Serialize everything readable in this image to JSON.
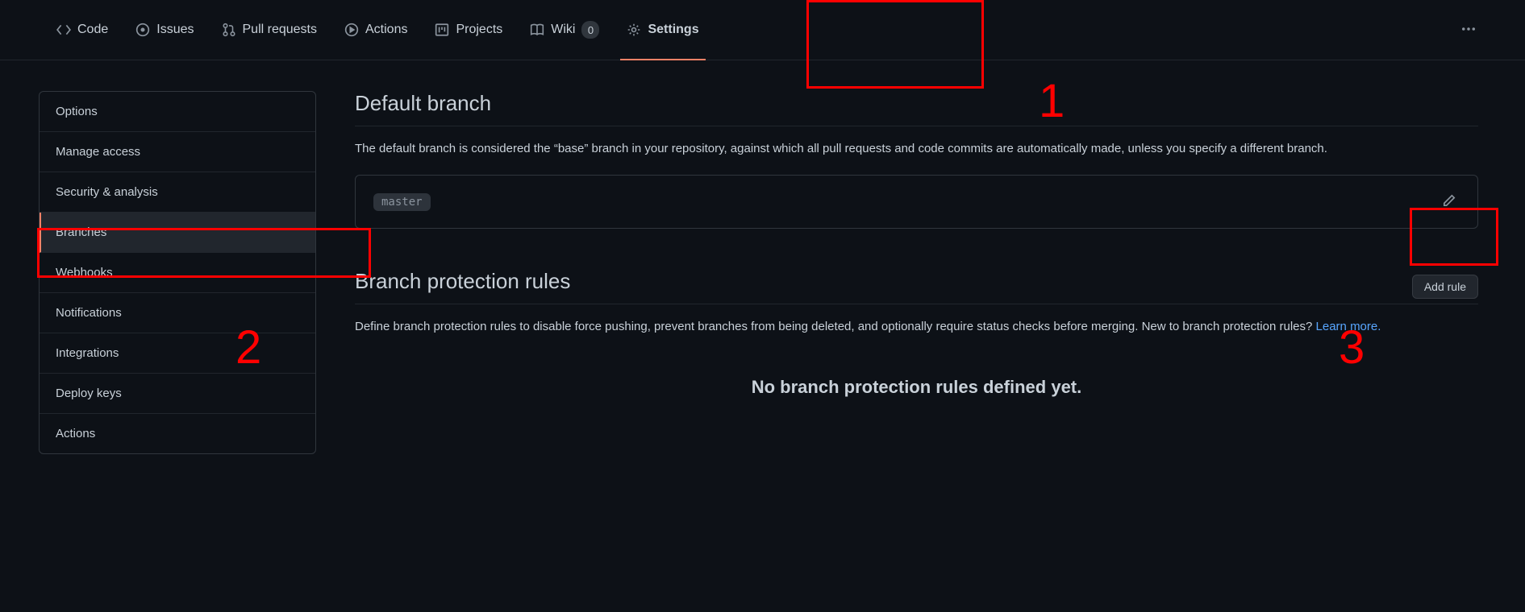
{
  "topnav": {
    "items": [
      {
        "label": "Code",
        "icon": "code"
      },
      {
        "label": "Issues",
        "icon": "issue"
      },
      {
        "label": "Pull requests",
        "icon": "pr"
      },
      {
        "label": "Actions",
        "icon": "play"
      },
      {
        "label": "Projects",
        "icon": "project"
      },
      {
        "label": "Wiki",
        "icon": "book",
        "count": "0"
      },
      {
        "label": "Settings",
        "icon": "gear",
        "selected": true
      }
    ]
  },
  "sidebar": {
    "items": [
      {
        "label": "Options"
      },
      {
        "label": "Manage access"
      },
      {
        "label": "Security & analysis"
      },
      {
        "label": "Branches",
        "active": true
      },
      {
        "label": "Webhooks"
      },
      {
        "label": "Notifications"
      },
      {
        "label": "Integrations"
      },
      {
        "label": "Deploy keys"
      },
      {
        "label": "Actions"
      }
    ]
  },
  "default_branch": {
    "title": "Default branch",
    "desc": "The default branch is considered the “base” branch in your repository, against which all pull requests and code commits are automatically made, unless you specify a different branch.",
    "branch_name": "master"
  },
  "protection": {
    "title": "Branch protection rules",
    "add_rule_label": "Add rule",
    "desc_prefix": "Define branch protection rules to disable force pushing, prevent branches from being deleted, and optionally require status checks before merging. New to branch protection rules? ",
    "learn_more": "Learn more.",
    "empty": "No branch protection rules defined yet."
  },
  "annotations": {
    "n1": "1",
    "n2": "2",
    "n3": "3"
  }
}
